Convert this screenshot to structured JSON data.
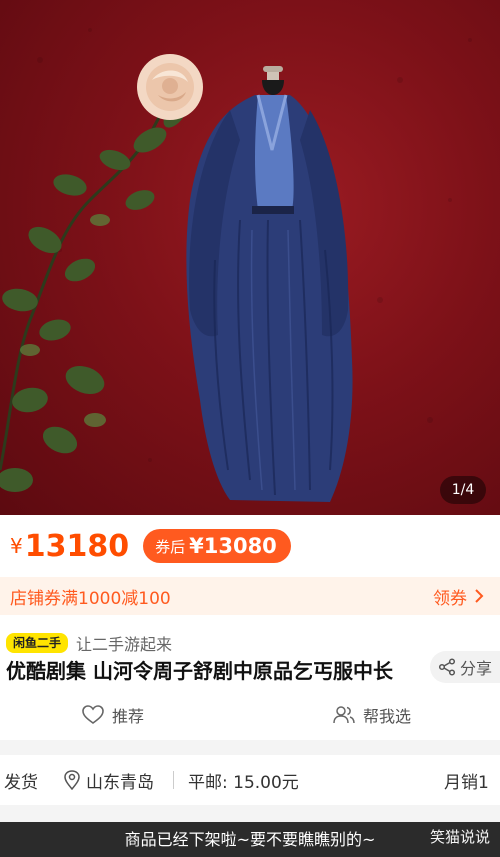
{
  "gallery": {
    "counter": "1/4"
  },
  "price": {
    "currency": "¥",
    "amount": "13180",
    "coupon_label": "券后",
    "coupon_price": "¥13080",
    "accent_color": "#ff4d00"
  },
  "shop_coupon": {
    "text": "店铺券满1000减100",
    "action": "领券"
  },
  "listing": {
    "platform_badge": "闲鱼二手",
    "tagline": "让二手游起来",
    "title": "优酷剧集 山河令周子舒剧中原品乞丐服中长",
    "share_label": "分享"
  },
  "actions": {
    "recommend": "推荐",
    "help_choose": "帮我选"
  },
  "shipping": {
    "label": "发货",
    "location": "山东青岛",
    "postage": "平邮: 15.00元",
    "sales": "月销1"
  },
  "caption": "商品已经下架啦~要不要瞧瞧别的~",
  "watermark": "笑猫说说",
  "icons": {
    "chevron": "chevron-right-icon",
    "share": "share-icon",
    "heart": "heart-icon",
    "users": "users-icon",
    "location": "location-pin-icon"
  }
}
